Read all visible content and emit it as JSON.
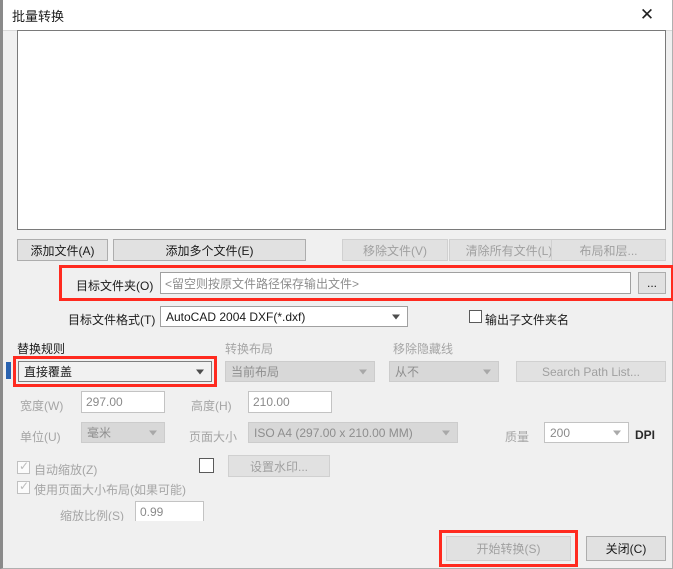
{
  "window": {
    "title": "批量转换",
    "close_icon": "close-icon",
    "close_glyph": "✕"
  },
  "file_list": {
    "items": [],
    "empty": ""
  },
  "file_buttons": [
    {
      "label": "添加文件(A)",
      "accel": "A",
      "disabled": false,
      "name": "add-file-button"
    },
    {
      "label": "添加多个文件(E)",
      "accel": "E",
      "disabled": false,
      "name": "add-multiple-files-button"
    },
    {
      "label": "移除文件(V)",
      "accel": "V",
      "disabled": true,
      "name": "remove-file-button"
    },
    {
      "label": "清除所有文件(L)",
      "accel": "L",
      "disabled": true,
      "name": "clear-all-files-button"
    },
    {
      "label": "布局和层...",
      "accel": "",
      "disabled": true,
      "name": "layouts-and-layers-button"
    }
  ],
  "target_folder": {
    "label": "目标文件夹(O)",
    "accel": "O",
    "value": "",
    "placeholder": "<留空则按原文件路径保存输出文件>",
    "browse_label": "...",
    "highlighted": true
  },
  "target_format": {
    "label": "目标文件格式(T)",
    "accel": "T",
    "value": "AutoCAD 2004 DXF(*.dxf)"
  },
  "output_subfolder": {
    "label": "输出子文件夹名",
    "checked": false
  },
  "replace_rule": {
    "label": "替换规则",
    "value": "直接覆盖",
    "disabled": false,
    "highlighted": true
  },
  "convert_layout": {
    "label": "转换布局",
    "value": "当前布局",
    "disabled": true
  },
  "remove_hidden_lines": {
    "label": "移除隐藏线",
    "value": "从不",
    "disabled": true
  },
  "search_path": {
    "label": "Search Path List...",
    "disabled": true
  },
  "width": {
    "label": "宽度(W)",
    "accel": "W",
    "value": "297.00",
    "disabled": true
  },
  "height": {
    "label": "高度(H)",
    "accel": "H",
    "value": "210.00",
    "disabled": true
  },
  "unit": {
    "label": "单位(U)",
    "accel": "U",
    "value": "毫米",
    "disabled": true
  },
  "page_size": {
    "label": "页面大小",
    "value": "ISO A4 (297.00 x 210.00 MM)",
    "disabled": true
  },
  "quality": {
    "label": "质量",
    "value": "200",
    "unit_label": "DPI",
    "disabled": true
  },
  "auto_scale": {
    "label": "自动缩放(Z)",
    "accel": "Z",
    "checked": true,
    "disabled": true
  },
  "use_page_layout": {
    "label": "使用页面大小布局(如果可能)",
    "checked": true,
    "disabled": true
  },
  "watermark": {
    "checkbox_checked": false,
    "button_label": "设置水印...",
    "disabled": true
  },
  "scale_ratio": {
    "label": "缩放比例(S)",
    "accel": "S",
    "value": "0.99",
    "disabled": true
  },
  "footer": {
    "start_label": "开始转换(S)",
    "start_accel": "S",
    "start_disabled": true,
    "start_highlighted": true,
    "close_label": "关闭(C)",
    "close_accel": "C",
    "close_disabled": false
  },
  "colors": {
    "highlight": "#ff2a1f",
    "accent_blue": "#2a63b0",
    "window_bg": "#f0f0f0"
  }
}
